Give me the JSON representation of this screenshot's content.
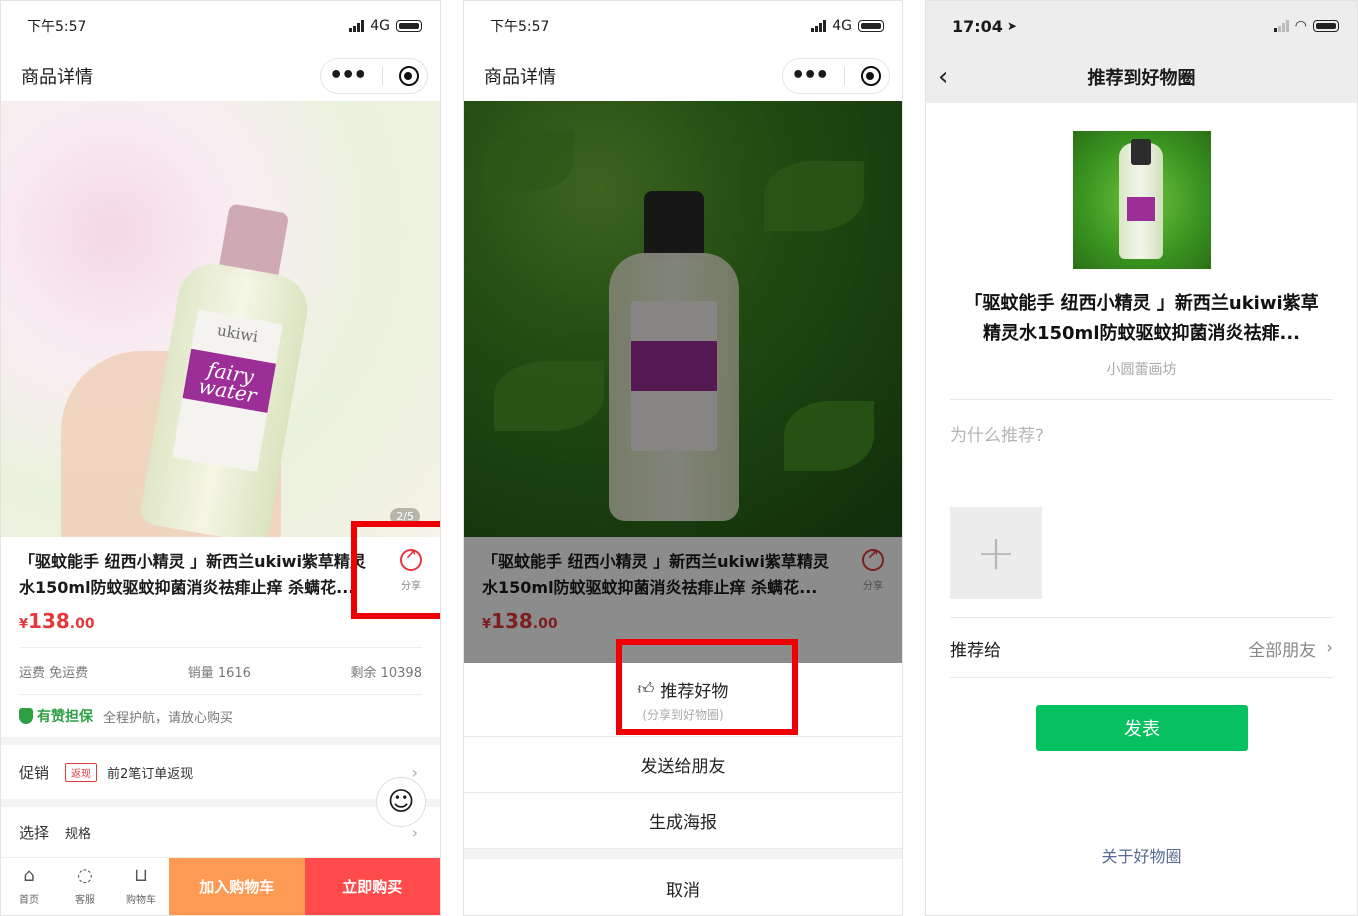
{
  "panel1": {
    "status_time": "下午5:57",
    "status_network": "4G",
    "nav_title": "商品详情",
    "image_indicator": "2/5",
    "bottle_brand": "ukiwi",
    "bottle_product": "fairy water",
    "product_title": "「驱蚊能手 纽西小精灵 」新西兰ukiwi紫草精灵水150ml防蚊驱蚊抑菌消炎祛痱止痒 杀螨花...",
    "share_label": "分享",
    "price_symbol": "¥",
    "price_int": "138",
    "price_dec": ".00",
    "shipping": "运费 免运费",
    "sales": "销量 1616",
    "stock": "剩余 10398",
    "guarantee_title": "有赞担保",
    "guarantee_desc": "全程护航，请放心购买",
    "promo_label": "促销",
    "promo_badge": "返现",
    "promo_text": "前2笔订单返现",
    "select_label": "选择",
    "select_value": "规格",
    "tabs": [
      {
        "label": "首页",
        "icon": "home-icon"
      },
      {
        "label": "客服",
        "icon": "chat-icon"
      },
      {
        "label": "购物车",
        "icon": "cart-icon"
      }
    ],
    "add_cart": "加入购物车",
    "buy_now": "立即购买"
  },
  "panel2": {
    "status_time": "下午5:57",
    "status_network": "4G",
    "nav_title": "商品详情",
    "product_title": "「驱蚊能手 纽西小精灵 」新西兰ukiwi紫草精灵水150ml防蚊驱蚊抑菌消炎祛痱止痒 杀螨花...",
    "share_label": "分享",
    "price_symbol": "¥",
    "price_int": "138",
    "price_dec": ".00",
    "sheet": {
      "recommend": "推荐好物",
      "recommend_hint": "(分享到好物圈)",
      "send_friend": "发送给朋友",
      "poster": "生成海报",
      "cancel": "取消"
    }
  },
  "panel3": {
    "status_time": "17:04",
    "nav_title": "推荐到好物圈",
    "product_title": "「驱蚊能手 纽西小精灵 」新西兰ukiwi紫草精灵水150ml防蚊驱蚊抑菌消炎祛痱...",
    "shop_name": "小圆蕾画坊",
    "why_placeholder": "为什么推荐?",
    "recommend_to_label": "推荐给",
    "recommend_to_value": "全部朋友",
    "publish": "发表",
    "about": "关于好物圈"
  },
  "colors": {
    "price_red": "#e4393c",
    "highlight_box": "#ee0000",
    "cart_orange": "#ff9a54",
    "buy_red": "#ff4b4b",
    "wechat_green": "#07c160",
    "guarantee_green": "#2ea043",
    "link_blue": "#576b95"
  }
}
